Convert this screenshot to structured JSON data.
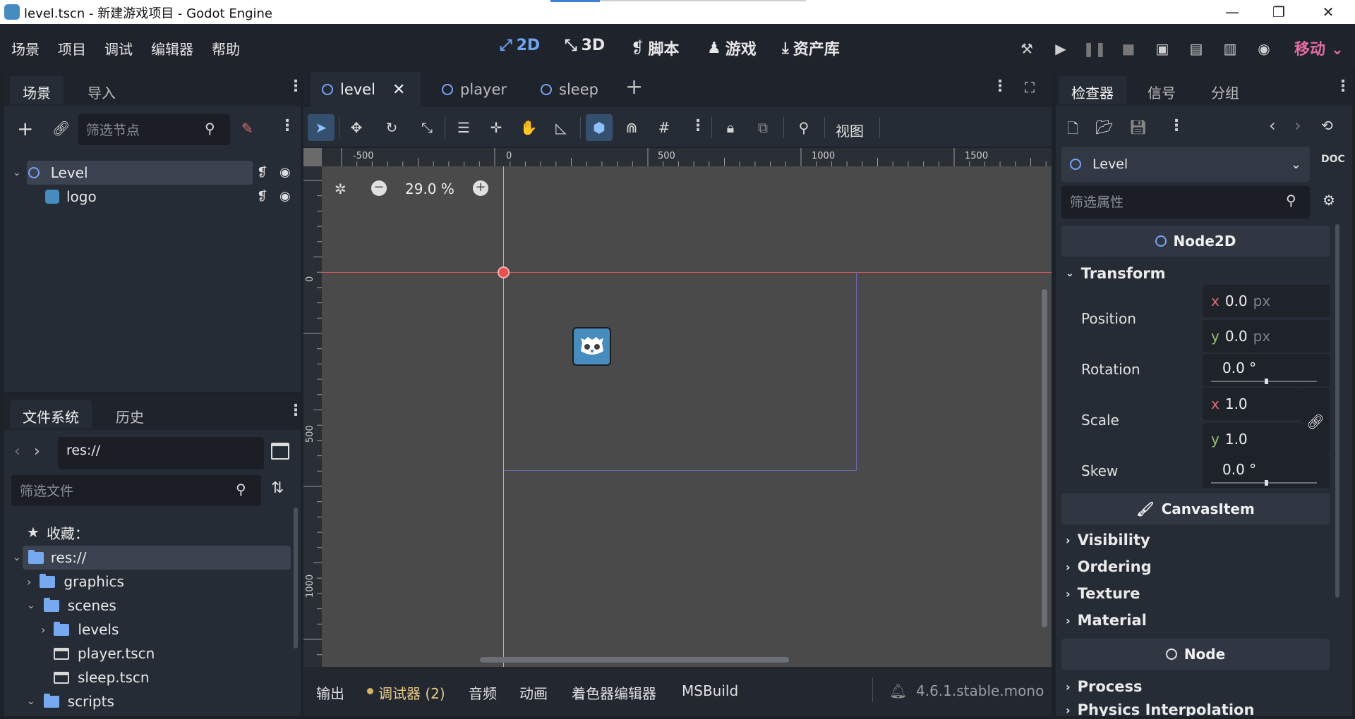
{
  "window": {
    "title": "level.tscn - 新建游戏项目 - Godot Engine",
    "controls": [
      "—",
      "❐",
      "✕"
    ]
  },
  "menu": [
    "场景",
    "项目",
    "调试",
    "编辑器",
    "帮助"
  ],
  "workspaces": [
    {
      "icon": "⤢",
      "label": "2D"
    },
    {
      "icon": "⤡",
      "label": "3D"
    },
    {
      "icon": "❡",
      "label": "脚本"
    },
    {
      "icon": "♟",
      "label": "游戏"
    },
    {
      "icon": "⤓",
      "label": "资产库"
    }
  ],
  "renderer": "移动",
  "scene_dock": {
    "tabs": [
      "场景",
      "导入"
    ],
    "filter_placeholder": "筛选节点",
    "nodes": [
      {
        "name": "Level"
      },
      {
        "name": "logo"
      }
    ]
  },
  "filesystem_dock": {
    "tabs": [
      "文件系统",
      "历史"
    ],
    "path": "res://",
    "filter_placeholder": "筛选文件",
    "favorites_label": "收藏：",
    "items": [
      {
        "name": "res://"
      },
      {
        "name": "graphics"
      },
      {
        "name": "scenes"
      },
      {
        "name": "levels"
      },
      {
        "name": "player.tscn"
      },
      {
        "name": "sleep.tscn"
      },
      {
        "name": "scripts"
      }
    ]
  },
  "editor_tabs": [
    {
      "label": "level"
    },
    {
      "label": "player"
    },
    {
      "label": "sleep"
    }
  ],
  "canvas_toolbar": {
    "view_menu": "视图"
  },
  "viewport": {
    "zoom": "29.0 %",
    "ruler_top": [
      "-500",
      "0",
      "500",
      "1000",
      "1500"
    ],
    "ruler_left": [
      "0",
      "500",
      "1000"
    ]
  },
  "bottom_panel": {
    "tabs": [
      "输出",
      "调试器 (2)",
      "音频",
      "动画",
      "着色器编辑器",
      "MSBuild"
    ],
    "version": "4.6.1.stable.mono"
  },
  "inspector": {
    "tabs": [
      "检查器",
      "信号",
      "分组"
    ],
    "selected_node": "Level",
    "filter_placeholder": "筛选属性",
    "node2d_section": "Node2D",
    "transform_label": "Transform",
    "props": {
      "position_label": "Position",
      "position_x": "0.0",
      "position_y": "0.0",
      "unit": "px",
      "rotation_label": "Rotation",
      "rotation_value": "0.0 °",
      "scale_label": "Scale",
      "scale_x": "1.0",
      "scale_y": "1.0",
      "skew_label": "Skew",
      "skew_value": "0.0 °"
    },
    "canvasitem_section": "CanvasItem",
    "canvasitem_cats": [
      "Visibility",
      "Ordering",
      "Texture",
      "Material"
    ],
    "node_section": "Node",
    "node_cats": [
      "Process",
      "Physics Interpolation"
    ]
  },
  "colors": {
    "accent": "#6fa4ef",
    "renderer": "#e26ca1",
    "panel": "#262c35",
    "viewport": "#4a4a4a"
  }
}
